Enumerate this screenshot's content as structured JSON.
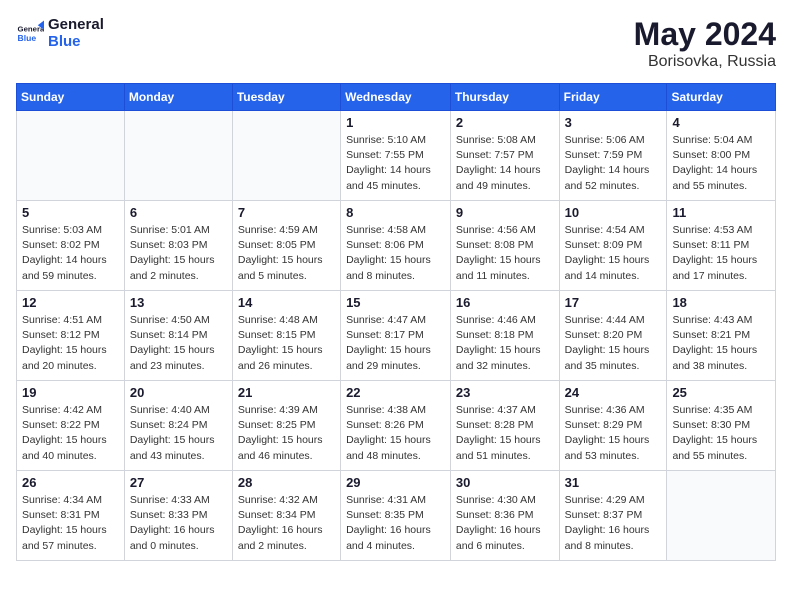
{
  "header": {
    "logo_line1": "General",
    "logo_line2": "Blue",
    "month_year": "May 2024",
    "location": "Borisovka, Russia"
  },
  "weekdays": [
    "Sunday",
    "Monday",
    "Tuesday",
    "Wednesday",
    "Thursday",
    "Friday",
    "Saturday"
  ],
  "weeks": [
    [
      {
        "day": "",
        "info": ""
      },
      {
        "day": "",
        "info": ""
      },
      {
        "day": "",
        "info": ""
      },
      {
        "day": "1",
        "info": "Sunrise: 5:10 AM\nSunset: 7:55 PM\nDaylight: 14 hours\nand 45 minutes."
      },
      {
        "day": "2",
        "info": "Sunrise: 5:08 AM\nSunset: 7:57 PM\nDaylight: 14 hours\nand 49 minutes."
      },
      {
        "day": "3",
        "info": "Sunrise: 5:06 AM\nSunset: 7:59 PM\nDaylight: 14 hours\nand 52 minutes."
      },
      {
        "day": "4",
        "info": "Sunrise: 5:04 AM\nSunset: 8:00 PM\nDaylight: 14 hours\nand 55 minutes."
      }
    ],
    [
      {
        "day": "5",
        "info": "Sunrise: 5:03 AM\nSunset: 8:02 PM\nDaylight: 14 hours\nand 59 minutes."
      },
      {
        "day": "6",
        "info": "Sunrise: 5:01 AM\nSunset: 8:03 PM\nDaylight: 15 hours\nand 2 minutes."
      },
      {
        "day": "7",
        "info": "Sunrise: 4:59 AM\nSunset: 8:05 PM\nDaylight: 15 hours\nand 5 minutes."
      },
      {
        "day": "8",
        "info": "Sunrise: 4:58 AM\nSunset: 8:06 PM\nDaylight: 15 hours\nand 8 minutes."
      },
      {
        "day": "9",
        "info": "Sunrise: 4:56 AM\nSunset: 8:08 PM\nDaylight: 15 hours\nand 11 minutes."
      },
      {
        "day": "10",
        "info": "Sunrise: 4:54 AM\nSunset: 8:09 PM\nDaylight: 15 hours\nand 14 minutes."
      },
      {
        "day": "11",
        "info": "Sunrise: 4:53 AM\nSunset: 8:11 PM\nDaylight: 15 hours\nand 17 minutes."
      }
    ],
    [
      {
        "day": "12",
        "info": "Sunrise: 4:51 AM\nSunset: 8:12 PM\nDaylight: 15 hours\nand 20 minutes."
      },
      {
        "day": "13",
        "info": "Sunrise: 4:50 AM\nSunset: 8:14 PM\nDaylight: 15 hours\nand 23 minutes."
      },
      {
        "day": "14",
        "info": "Sunrise: 4:48 AM\nSunset: 8:15 PM\nDaylight: 15 hours\nand 26 minutes."
      },
      {
        "day": "15",
        "info": "Sunrise: 4:47 AM\nSunset: 8:17 PM\nDaylight: 15 hours\nand 29 minutes."
      },
      {
        "day": "16",
        "info": "Sunrise: 4:46 AM\nSunset: 8:18 PM\nDaylight: 15 hours\nand 32 minutes."
      },
      {
        "day": "17",
        "info": "Sunrise: 4:44 AM\nSunset: 8:20 PM\nDaylight: 15 hours\nand 35 minutes."
      },
      {
        "day": "18",
        "info": "Sunrise: 4:43 AM\nSunset: 8:21 PM\nDaylight: 15 hours\nand 38 minutes."
      }
    ],
    [
      {
        "day": "19",
        "info": "Sunrise: 4:42 AM\nSunset: 8:22 PM\nDaylight: 15 hours\nand 40 minutes."
      },
      {
        "day": "20",
        "info": "Sunrise: 4:40 AM\nSunset: 8:24 PM\nDaylight: 15 hours\nand 43 minutes."
      },
      {
        "day": "21",
        "info": "Sunrise: 4:39 AM\nSunset: 8:25 PM\nDaylight: 15 hours\nand 46 minutes."
      },
      {
        "day": "22",
        "info": "Sunrise: 4:38 AM\nSunset: 8:26 PM\nDaylight: 15 hours\nand 48 minutes."
      },
      {
        "day": "23",
        "info": "Sunrise: 4:37 AM\nSunset: 8:28 PM\nDaylight: 15 hours\nand 51 minutes."
      },
      {
        "day": "24",
        "info": "Sunrise: 4:36 AM\nSunset: 8:29 PM\nDaylight: 15 hours\nand 53 minutes."
      },
      {
        "day": "25",
        "info": "Sunrise: 4:35 AM\nSunset: 8:30 PM\nDaylight: 15 hours\nand 55 minutes."
      }
    ],
    [
      {
        "day": "26",
        "info": "Sunrise: 4:34 AM\nSunset: 8:31 PM\nDaylight: 15 hours\nand 57 minutes."
      },
      {
        "day": "27",
        "info": "Sunrise: 4:33 AM\nSunset: 8:33 PM\nDaylight: 16 hours\nand 0 minutes."
      },
      {
        "day": "28",
        "info": "Sunrise: 4:32 AM\nSunset: 8:34 PM\nDaylight: 16 hours\nand 2 minutes."
      },
      {
        "day": "29",
        "info": "Sunrise: 4:31 AM\nSunset: 8:35 PM\nDaylight: 16 hours\nand 4 minutes."
      },
      {
        "day": "30",
        "info": "Sunrise: 4:30 AM\nSunset: 8:36 PM\nDaylight: 16 hours\nand 6 minutes."
      },
      {
        "day": "31",
        "info": "Sunrise: 4:29 AM\nSunset: 8:37 PM\nDaylight: 16 hours\nand 8 minutes."
      },
      {
        "day": "",
        "info": ""
      }
    ]
  ]
}
